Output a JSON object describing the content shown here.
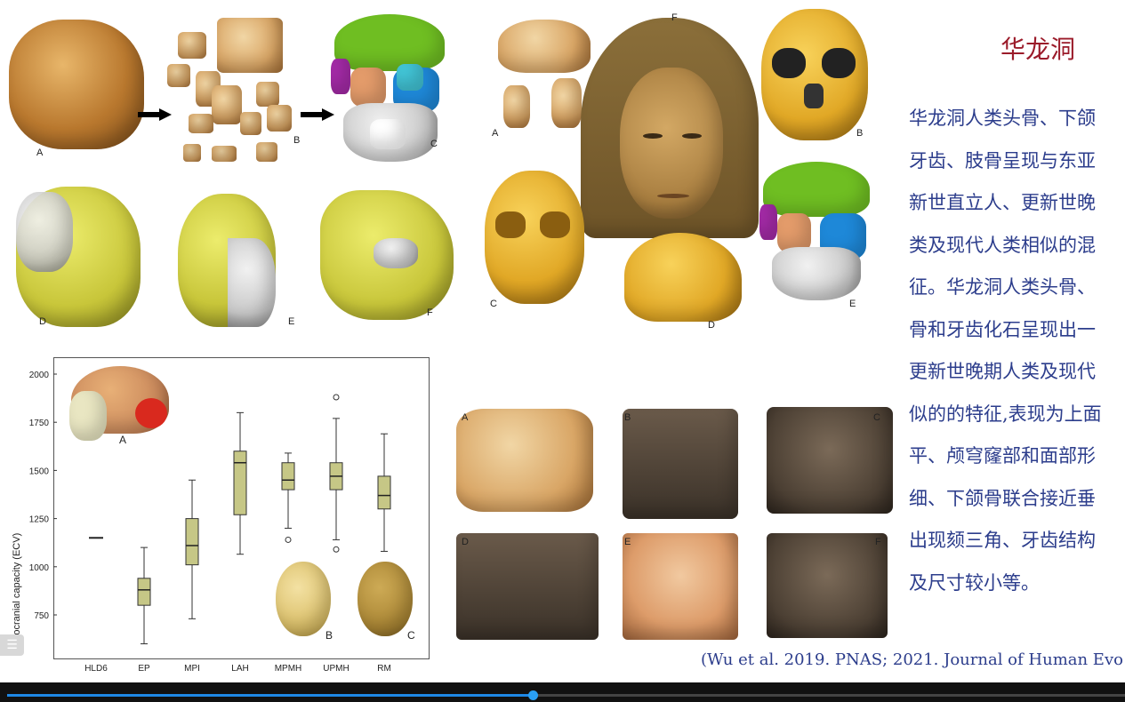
{
  "slide": {
    "title": "华龙洞",
    "body_lines": [
      "华龙洞人类头骨、下颌",
      "牙齿、肢骨呈现与东亚",
      "新世直立人、更新世晚",
      "类及现代人类相似的混",
      "征。华龙洞人类头骨、",
      "骨和牙齿化石呈现出一",
      "更新世晚期人类及现代",
      "似的的特征,表现为上面",
      "平、颅穹窿部和面部形",
      "细、下颌骨联合接近垂",
      "出现颏三角、牙齿结构",
      "及尺寸较小等。"
    ],
    "citation": "(Wu et al. 2019. PNAS; 2021. Journal of Human Evo",
    "panel1_labels": [
      "A",
      "B",
      "C",
      "D",
      "E",
      "F"
    ],
    "panel2_labels": [
      "A",
      "B",
      "C",
      "D",
      "E",
      "F"
    ],
    "panel3_labels": [
      "A",
      "B",
      "C",
      "D",
      "E",
      "F"
    ],
    "chart_inset_labels": [
      "A",
      "B",
      "C"
    ]
  },
  "chart_data": {
    "type": "box",
    "ylabel": "Endocranial capacity (ECV)",
    "y_ticks": [
      "750",
      "1000",
      "1250",
      "1500",
      "1750",
      "2000"
    ],
    "ylim": [
      650,
      2050
    ],
    "categories": [
      "HLD6",
      "EP",
      "MPI",
      "LAH",
      "MPMH",
      "UPMH",
      "RM"
    ],
    "boxes": [
      {
        "name": "HLD6",
        "single": 1150
      },
      {
        "name": "EP",
        "min": 600,
        "q1": 800,
        "median": 880,
        "q3": 940,
        "max": 1100,
        "outliers": []
      },
      {
        "name": "MPI",
        "min": 730,
        "q1": 1010,
        "median": 1110,
        "q3": 1250,
        "max": 1450,
        "outliers": []
      },
      {
        "name": "LAH",
        "min": 1065,
        "q1": 1270,
        "median": 1540,
        "q3": 1600,
        "max": 1800,
        "outliers": []
      },
      {
        "name": "MPMH",
        "min": 1200,
        "q1": 1400,
        "median": 1450,
        "q3": 1540,
        "max": 1590,
        "outliers": [
          1140
        ]
      },
      {
        "name": "UPMH",
        "min": 1140,
        "q1": 1400,
        "median": 1470,
        "q3": 1540,
        "max": 1770,
        "outliers": [
          1880,
          1090
        ]
      },
      {
        "name": "RM",
        "min": 1080,
        "q1": 1300,
        "median": 1370,
        "q3": 1470,
        "max": 1690,
        "outliers": []
      }
    ],
    "box_color": "#c6c786"
  },
  "player": {
    "progress": 0.47
  }
}
